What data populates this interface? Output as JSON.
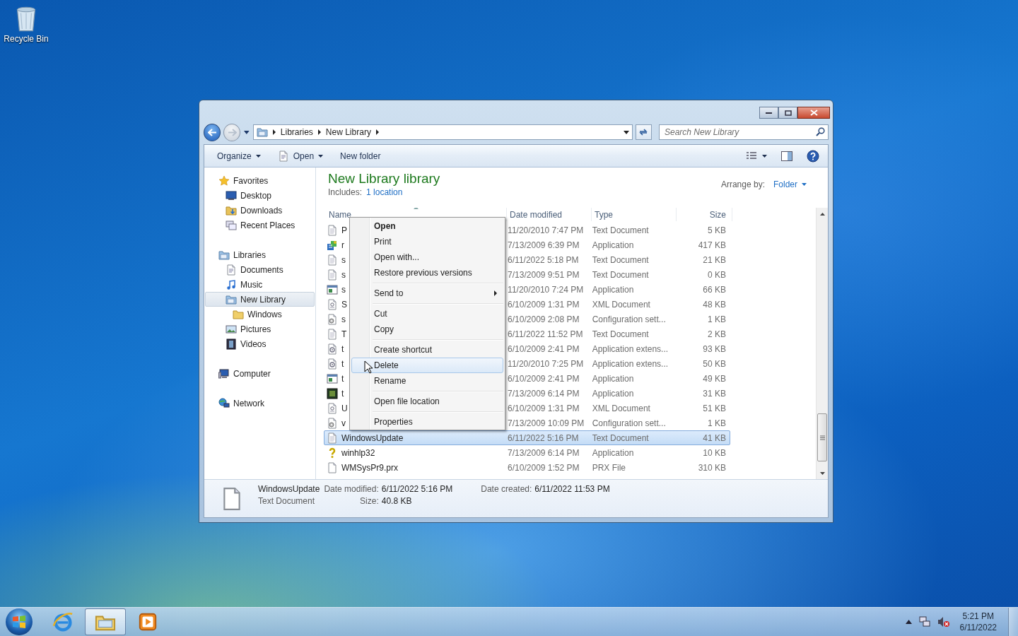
{
  "desktop": {
    "icons": [
      {
        "kind": "recycle-bin",
        "label": "Recycle Bin"
      }
    ]
  },
  "window": {
    "address": {
      "crumbs": [
        "Libraries",
        "New Library"
      ]
    },
    "search": {
      "placeholder": "Search New Library"
    },
    "toolbar": {
      "buttons": [
        {
          "kind": "menu",
          "label": "Organize"
        },
        {
          "kind": "open",
          "label": "Open"
        },
        {
          "kind": "plain",
          "label": "New folder"
        }
      ]
    },
    "nav": [
      {
        "kind": "star",
        "label": "Favorites",
        "selected": false,
        "children": [
          {
            "kind": "desktop",
            "label": "Desktop",
            "selected": false
          },
          {
            "kind": "downloads",
            "label": "Downloads",
            "selected": false
          },
          {
            "kind": "recent",
            "label": "Recent Places",
            "selected": false
          }
        ]
      },
      {
        "kind": "library",
        "label": "Libraries",
        "selected": false,
        "children": [
          {
            "kind": "documents",
            "label": "Documents",
            "selected": false
          },
          {
            "kind": "music",
            "label": "Music",
            "selected": false
          },
          {
            "kind": "library",
            "label": "New Library",
            "selected": true,
            "children": [
              {
                "kind": "folder",
                "label": "Windows",
                "selected": false
              }
            ]
          },
          {
            "kind": "pictures",
            "label": "Pictures",
            "selected": false
          },
          {
            "kind": "videos",
            "label": "Videos",
            "selected": false
          }
        ]
      },
      {
        "kind": "computer",
        "label": "Computer",
        "selected": false
      },
      {
        "kind": "network",
        "label": "Network",
        "selected": false
      }
    ],
    "library": {
      "title": "New Library library",
      "includes_label": "Includes:",
      "includes_link": "1 location",
      "arrange_label": "Arrange by:",
      "arrange_value": "Folder"
    },
    "table": {
      "columns": [
        "Name",
        "Date modified",
        "Type",
        "Size"
      ],
      "rows": [
        {
          "kind": "text",
          "name": "P",
          "date_modified": "11/20/2010 7:47 PM",
          "type": "Text Document",
          "size": "5 KB",
          "selected": false
        },
        {
          "kind": "setup",
          "name": "r",
          "date_modified": "7/13/2009 6:39 PM",
          "type": "Application",
          "size": "417 KB",
          "selected": false
        },
        {
          "kind": "text",
          "name": "s",
          "date_modified": "6/11/2022 5:18 PM",
          "type": "Text Document",
          "size": "21 KB",
          "selected": false
        },
        {
          "kind": "text",
          "name": "s",
          "date_modified": "7/13/2009 9:51 PM",
          "type": "Text Document",
          "size": "0 KB",
          "selected": false
        },
        {
          "kind": "app",
          "name": "s",
          "date_modified": "11/20/2010 7:24 PM",
          "type": "Application",
          "size": "66 KB",
          "selected": false
        },
        {
          "kind": "xml",
          "name": "S",
          "date_modified": "6/10/2009 1:31 PM",
          "type": "XML Document",
          "size": "48 KB",
          "selected": false
        },
        {
          "kind": "config",
          "name": "s",
          "date_modified": "6/10/2009 2:08 PM",
          "type": "Configuration sett...",
          "size": "1 KB",
          "selected": false
        },
        {
          "kind": "text",
          "name": "T",
          "date_modified": "6/11/2022 11:52 PM",
          "type": "Text Document",
          "size": "2 KB",
          "selected": false
        },
        {
          "kind": "extension",
          "name": "t",
          "date_modified": "6/10/2009 2:41 PM",
          "type": "Application extens...",
          "size": "93 KB",
          "selected": false
        },
        {
          "kind": "extension",
          "name": "t",
          "date_modified": "11/20/2010 7:25 PM",
          "type": "Application extens...",
          "size": "50 KB",
          "selected": false
        },
        {
          "kind": "app",
          "name": "t",
          "date_modified": "6/10/2009 2:41 PM",
          "type": "Application",
          "size": "49 KB",
          "selected": false
        },
        {
          "kind": "game",
          "name": "t",
          "date_modified": "7/13/2009 6:14 PM",
          "type": "Application",
          "size": "31 KB",
          "selected": false
        },
        {
          "kind": "xml",
          "name": "U",
          "date_modified": "6/10/2009 1:31 PM",
          "type": "XML Document",
          "size": "51 KB",
          "selected": false
        },
        {
          "kind": "config",
          "name": "v",
          "date_modified": "7/13/2009 10:09 PM",
          "type": "Configuration sett...",
          "size": "1 KB",
          "selected": false
        },
        {
          "kind": "text",
          "name": "WindowsUpdate",
          "date_modified": "6/11/2022 5:16 PM",
          "type": "Text Document",
          "size": "41 KB",
          "selected": true
        },
        {
          "kind": "help",
          "name": "winhlp32",
          "date_modified": "7/13/2009 6:14 PM",
          "type": "Application",
          "size": "10 KB",
          "selected": false
        },
        {
          "kind": "file",
          "name": "WMSysPr9.prx",
          "date_modified": "6/10/2009 1:52 PM",
          "type": "PRX File",
          "size": "310 KB",
          "selected": false
        }
      ]
    },
    "context_menu": {
      "groups": [
        [
          {
            "label": "Open",
            "default": true,
            "submenu": false,
            "highlighted": false
          },
          {
            "label": "Print",
            "default": false,
            "submenu": false,
            "highlighted": false
          },
          {
            "label": "Open with...",
            "default": false,
            "submenu": false,
            "highlighted": false
          },
          {
            "label": "Restore previous versions",
            "default": false,
            "submenu": false,
            "highlighted": false
          }
        ],
        [
          {
            "label": "Send to",
            "default": false,
            "submenu": true,
            "highlighted": false
          }
        ],
        [
          {
            "label": "Cut",
            "default": false,
            "submenu": false,
            "highlighted": false
          },
          {
            "label": "Copy",
            "default": false,
            "submenu": false,
            "highlighted": false
          }
        ],
        [
          {
            "label": "Create shortcut",
            "default": false,
            "submenu": false,
            "highlighted": false
          },
          {
            "label": "Delete",
            "default": false,
            "submenu": false,
            "highlighted": true
          },
          {
            "label": "Rename",
            "default": false,
            "submenu": false,
            "highlighted": false
          }
        ],
        [
          {
            "label": "Open file location",
            "default": false,
            "submenu": false,
            "highlighted": false
          }
        ],
        [
          {
            "label": "Properties",
            "default": false,
            "submenu": false,
            "highlighted": false
          }
        ]
      ]
    },
    "details": {
      "name": "WindowsUpdate",
      "type": "Text Document",
      "columns": [
        [
          {
            "label": "Date modified:",
            "value": "6/11/2022 5:16 PM"
          },
          {
            "label": "Size:",
            "value": "40.8 KB"
          }
        ],
        [
          {
            "label": "Date created:",
            "value": "6/11/2022 11:53 PM"
          }
        ]
      ]
    }
  },
  "taskbar": {
    "items": [
      {
        "kind": "browser",
        "selected": false
      },
      {
        "kind": "explorer",
        "selected": true
      },
      {
        "kind": "media",
        "selected": false
      }
    ],
    "clock": {
      "time": "5:21 PM",
      "date": "6/11/2022"
    }
  }
}
